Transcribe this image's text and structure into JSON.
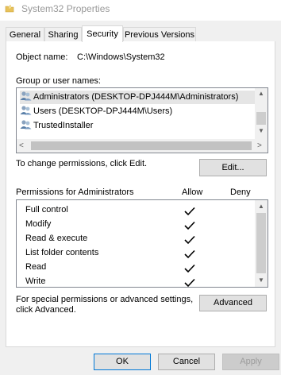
{
  "window": {
    "title": "System32 Properties",
    "title_icon": "folder-icon"
  },
  "tabs": [
    {
      "label": "General"
    },
    {
      "label": "Sharing"
    },
    {
      "label": "Security"
    },
    {
      "label": "Previous Versions"
    }
  ],
  "active_tab": "Security",
  "object_name": {
    "label": "Object name:",
    "value": "C:\\Windows\\System32"
  },
  "group_list": {
    "label": "Group or user names:",
    "items": [
      {
        "name": "Administrators (DESKTOP-DPJ444M\\Administrators)",
        "selected": true
      },
      {
        "name": "Users (DESKTOP-DPJ444M\\Users)",
        "selected": false
      },
      {
        "name": "TrustedInstaller",
        "selected": false
      }
    ]
  },
  "change_permissions": {
    "text": "To change permissions, click Edit.",
    "button": "Edit..."
  },
  "permissions": {
    "label": "Permissions for Administrators",
    "allow_header": "Allow",
    "deny_header": "Deny",
    "rows": [
      {
        "name": "Full control",
        "allow": true,
        "deny": false
      },
      {
        "name": "Modify",
        "allow": true,
        "deny": false
      },
      {
        "name": "Read & execute",
        "allow": true,
        "deny": false
      },
      {
        "name": "List folder contents",
        "allow": true,
        "deny": false
      },
      {
        "name": "Read",
        "allow": true,
        "deny": false
      },
      {
        "name": "Write",
        "allow": true,
        "deny": false
      }
    ]
  },
  "advanced": {
    "text_line1": "For special permissions or advanced settings,",
    "text_line2": "click Advanced.",
    "button": "Advanced"
  },
  "footer": {
    "ok": "OK",
    "cancel": "Cancel",
    "apply": "Apply",
    "apply_enabled": false
  },
  "colors": {
    "title_text": "#999999",
    "selection": "#e5e5e5",
    "list_border": "#828790",
    "button_face": "#e1e1e1"
  }
}
